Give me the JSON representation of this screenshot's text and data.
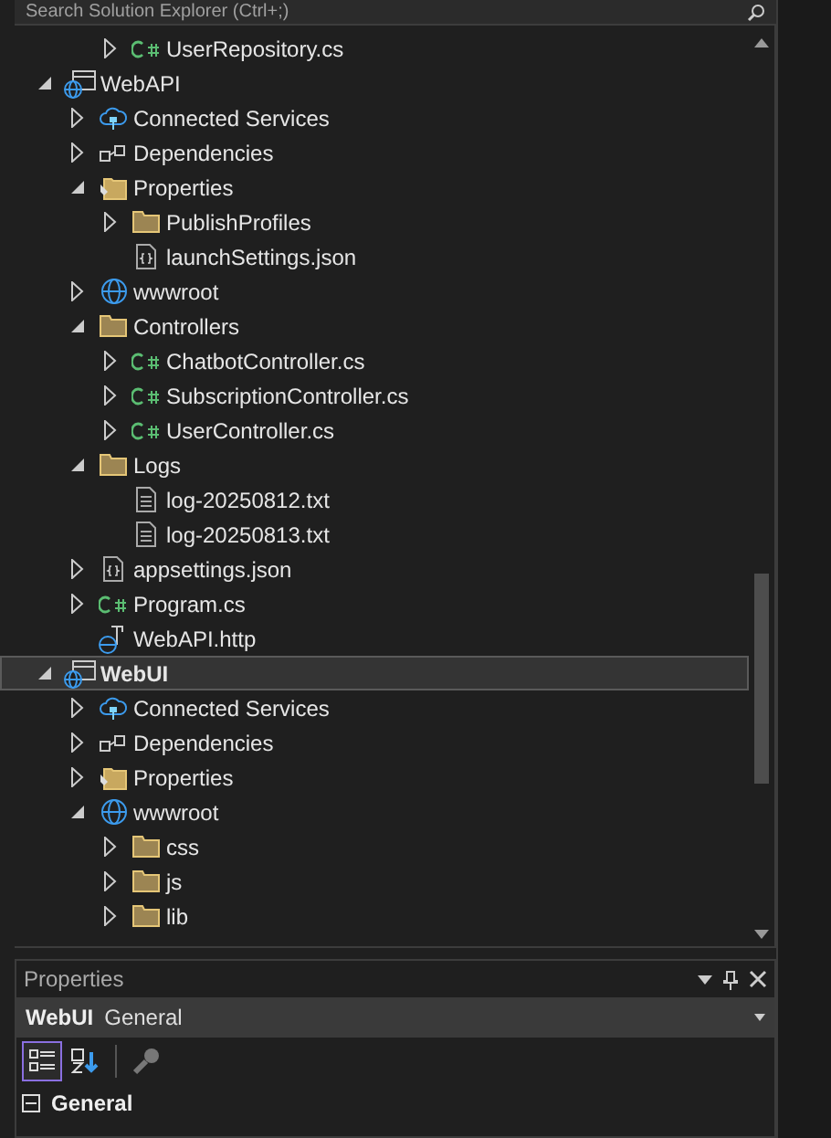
{
  "search": {
    "placeholder": "Search Solution Explorer (Ctrl+;)"
  },
  "scrolled_item": {
    "label": "UserRepository.cs",
    "kind": "csharp",
    "expanded": false,
    "selected": false
  },
  "tree": [
    {
      "label": "WebAPI",
      "kind": "project",
      "expanded": true,
      "selected": false,
      "children": [
        {
          "label": "Connected Services",
          "kind": "cloud",
          "expanded": false,
          "selected": false
        },
        {
          "label": "Dependencies",
          "kind": "dependencies",
          "expanded": false,
          "selected": false
        },
        {
          "label": "Properties",
          "kind": "properties",
          "expanded": true,
          "selected": false,
          "children": [
            {
              "label": "PublishProfiles",
              "kind": "folder",
              "expanded": false,
              "selected": false
            },
            {
              "label": "launchSettings.json",
              "kind": "json",
              "selected": false
            }
          ]
        },
        {
          "label": "wwwroot",
          "kind": "globe",
          "expanded": false,
          "selected": false
        },
        {
          "label": "Controllers",
          "kind": "folder",
          "expanded": true,
          "selected": false,
          "children": [
            {
              "label": "ChatbotController.cs",
              "kind": "csharp",
              "expanded": false,
              "selected": false
            },
            {
              "label": "SubscriptionController.cs",
              "kind": "csharp",
              "expanded": false,
              "selected": false
            },
            {
              "label": "UserController.cs",
              "kind": "csharp",
              "expanded": false,
              "selected": false
            }
          ]
        },
        {
          "label": "Logs",
          "kind": "folder",
          "expanded": true,
          "selected": false,
          "children": [
            {
              "label": "log-20250812.txt",
              "kind": "text",
              "selected": false
            },
            {
              "label": "log-20250813.txt",
              "kind": "text",
              "selected": false
            }
          ]
        },
        {
          "label": "appsettings.json",
          "kind": "json",
          "expanded": false,
          "selected": false
        },
        {
          "label": "Program.cs",
          "kind": "csharp",
          "expanded": false,
          "selected": false
        },
        {
          "label": "WebAPI.http",
          "kind": "http",
          "selected": false
        }
      ]
    },
    {
      "label": "WebUI",
      "kind": "project",
      "expanded": true,
      "selected": true,
      "children": [
        {
          "label": "Connected Services",
          "kind": "cloud",
          "expanded": false,
          "selected": false
        },
        {
          "label": "Dependencies",
          "kind": "dependencies",
          "expanded": false,
          "selected": false
        },
        {
          "label": "Properties",
          "kind": "properties",
          "expanded": false,
          "selected": false
        },
        {
          "label": "wwwroot",
          "kind": "globe",
          "expanded": true,
          "selected": false,
          "children": [
            {
              "label": "css",
              "kind": "folder",
              "expanded": false,
              "selected": false
            },
            {
              "label": "js",
              "kind": "folder",
              "expanded": false,
              "selected": false
            },
            {
              "label": "lib",
              "kind": "folder",
              "expanded": false,
              "selected": false
            }
          ]
        }
      ]
    }
  ],
  "properties": {
    "title": "Properties",
    "object_name": "WebUI",
    "object_type": "General",
    "toolbar": [
      {
        "kind": "categorized",
        "selected": true
      },
      {
        "kind": "alphabetical",
        "selected": false
      },
      {
        "kind": "pages",
        "selected": false
      }
    ],
    "category": {
      "label": "General",
      "expanded": true
    }
  }
}
